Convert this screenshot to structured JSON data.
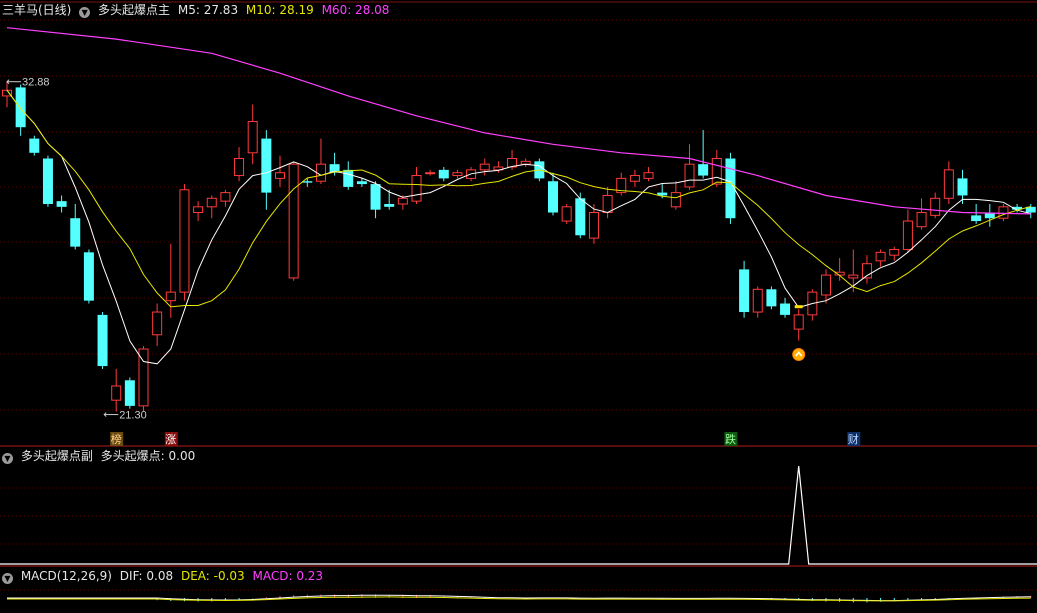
{
  "main_panel": {
    "stock_name": "三羊马(日线)",
    "indicator": "多头起爆点主",
    "ma5": "M5: 27.83",
    "ma10": "M10: 28.19",
    "ma60": "M60: 28.08",
    "high_label": "32.88",
    "low_label": "21.30",
    "markers": [
      "榜",
      "涨",
      "跌",
      "财"
    ],
    "colors": {
      "up": "#ff3b3b",
      "down": "#54ffff",
      "ma5": "#ffffff",
      "ma10": "#e6e600",
      "ma60": "#ff40ff"
    }
  },
  "sub_panel": {
    "indicator": "多头起爆点副",
    "value_text": "多头起爆点: 0.00"
  },
  "macd_panel": {
    "indicator": "MACD(12,26,9)",
    "dif": "DIF: 0.08",
    "dea": "DEA: -0.03",
    "macd": "MACD: 0.23"
  },
  "chart_data": {
    "type": "candlestick",
    "ohlc": [
      [
        32.4,
        32.9,
        32.0,
        32.6
      ],
      [
        32.7,
        32.8,
        31.0,
        31.3
      ],
      [
        30.9,
        31.0,
        30.3,
        30.4
      ],
      [
        30.2,
        30.3,
        28.5,
        28.6
      ],
      [
        28.7,
        28.9,
        28.3,
        28.5
      ],
      [
        28.1,
        28.6,
        27.0,
        27.1
      ],
      [
        26.9,
        27.0,
        25.1,
        25.2
      ],
      [
        24.7,
        24.8,
        22.8,
        22.9
      ],
      [
        21.7,
        22.8,
        21.3,
        22.2
      ],
      [
        22.4,
        22.5,
        21.4,
        21.5
      ],
      [
        21.5,
        23.6,
        21.3,
        23.5
      ],
      [
        24.0,
        25.1,
        23.6,
        24.8
      ],
      [
        25.2,
        27.2,
        24.6,
        25.5
      ],
      [
        25.5,
        29.3,
        25.2,
        29.1
      ],
      [
        28.3,
        28.7,
        28.0,
        28.5
      ],
      [
        28.5,
        28.9,
        28.1,
        28.8
      ],
      [
        28.7,
        29.1,
        28.5,
        29.0
      ],
      [
        29.6,
        30.6,
        29.4,
        30.2
      ],
      [
        30.4,
        32.1,
        30.0,
        31.5
      ],
      [
        30.9,
        31.2,
        28.4,
        29.0
      ],
      [
        29.5,
        30.3,
        29.2,
        29.7
      ],
      [
        26.0,
        30.1,
        25.9,
        30.0
      ],
      [
        29.4,
        29.5,
        29.2,
        29.35
      ],
      [
        29.4,
        30.9,
        29.3,
        30.0
      ],
      [
        30.0,
        30.4,
        29.6,
        29.7
      ],
      [
        29.8,
        30.1,
        29.1,
        29.2
      ],
      [
        29.4,
        29.5,
        29.2,
        29.3
      ],
      [
        29.3,
        29.4,
        28.1,
        28.4
      ],
      [
        28.6,
        29.1,
        28.4,
        28.5
      ],
      [
        28.6,
        28.9,
        28.4,
        28.8
      ],
      [
        28.7,
        29.9,
        28.6,
        29.6
      ],
      [
        29.7,
        29.8,
        29.6,
        29.7
      ],
      [
        29.8,
        29.9,
        29.4,
        29.5
      ],
      [
        29.6,
        29.8,
        29.5,
        29.7
      ],
      [
        29.5,
        29.9,
        29.4,
        29.8
      ],
      [
        29.8,
        30.2,
        29.6,
        30.0
      ],
      [
        29.8,
        30.1,
        29.7,
        29.9
      ],
      [
        29.9,
        30.5,
        29.8,
        30.2
      ],
      [
        30.0,
        30.2,
        29.9,
        30.1
      ],
      [
        30.1,
        30.2,
        29.4,
        29.5
      ],
      [
        29.4,
        29.7,
        28.2,
        28.3
      ],
      [
        28.0,
        28.6,
        27.9,
        28.5
      ],
      [
        28.8,
        29.0,
        27.4,
        27.5
      ],
      [
        27.4,
        28.6,
        27.2,
        28.3
      ],
      [
        28.3,
        29.2,
        28.1,
        28.9
      ],
      [
        29.0,
        29.7,
        28.9,
        29.5
      ],
      [
        29.4,
        29.8,
        29.2,
        29.6
      ],
      [
        29.5,
        29.9,
        29.4,
        29.7
      ],
      [
        29.0,
        29.3,
        28.8,
        28.9
      ],
      [
        28.5,
        29.4,
        28.4,
        29.0
      ],
      [
        29.2,
        30.7,
        29.1,
        30.0
      ],
      [
        30.0,
        31.2,
        29.5,
        29.6
      ],
      [
        29.3,
        30.5,
        29.2,
        30.2
      ],
      [
        30.2,
        30.4,
        27.9,
        28.1
      ],
      [
        26.3,
        26.6,
        24.6,
        24.8
      ],
      [
        24.8,
        25.7,
        24.6,
        25.6
      ],
      [
        25.6,
        25.7,
        24.9,
        25.0
      ],
      [
        25.1,
        25.3,
        24.6,
        24.7
      ],
      [
        24.2,
        24.9,
        23.8,
        24.7
      ],
      [
        24.7,
        25.6,
        24.5,
        25.5
      ],
      [
        25.4,
        26.3,
        25.1,
        26.1
      ],
      [
        26.1,
        26.7,
        25.9,
        26.2
      ],
      [
        26.0,
        27.0,
        25.5,
        26.1
      ],
      [
        26.0,
        26.8,
        25.8,
        26.5
      ],
      [
        26.6,
        27.0,
        26.4,
        26.9
      ],
      [
        26.8,
        27.1,
        26.6,
        27.0
      ],
      [
        27.0,
        28.4,
        26.9,
        28.0
      ],
      [
        27.8,
        28.8,
        27.7,
        28.3
      ],
      [
        28.2,
        29.0,
        28.1,
        28.8
      ],
      [
        28.8,
        30.1,
        28.6,
        29.8
      ],
      [
        29.5,
        29.8,
        28.6,
        28.9
      ],
      [
        28.2,
        28.6,
        27.9,
        28.0
      ],
      [
        28.3,
        28.6,
        27.8,
        28.1
      ],
      [
        28.1,
        28.6,
        28.0,
        28.5
      ],
      [
        28.5,
        28.6,
        28.3,
        28.4
      ],
      [
        28.5,
        28.6,
        28.1,
        28.3
      ]
    ],
    "ma60": [
      [
        0,
        34.8
      ],
      [
        8,
        34.4
      ],
      [
        15,
        33.9
      ],
      [
        20,
        33.2
      ],
      [
        25,
        32.4
      ],
      [
        30,
        31.7
      ],
      [
        35,
        31.1
      ],
      [
        40,
        30.7
      ],
      [
        45,
        30.4
      ],
      [
        50,
        30.2
      ],
      [
        55,
        29.6
      ],
      [
        60,
        28.9
      ],
      [
        65,
        28.5
      ],
      [
        70,
        28.3
      ],
      [
        75,
        28.25
      ]
    ],
    "ylim": [
      20.3,
      35.0
    ],
    "signal_spike_index": 58,
    "macd_dif": 0.08,
    "macd_dea": -0.03,
    "macd_value": 0.23
  }
}
